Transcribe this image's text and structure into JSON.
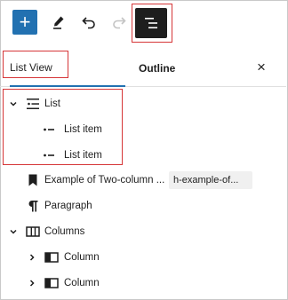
{
  "toolbar": {
    "add_label": "+",
    "items": [
      {
        "name": "add-block",
        "icon": "plus-icon"
      },
      {
        "name": "tools",
        "icon": "pencil-icon"
      },
      {
        "name": "undo",
        "icon": "undo-icon"
      },
      {
        "name": "redo",
        "icon": "redo-icon"
      },
      {
        "name": "list-view",
        "icon": "list-view-icon"
      }
    ],
    "accent": "#2271b1"
  },
  "tabs": [
    {
      "label": "List View",
      "active": true
    },
    {
      "label": "Outline",
      "active": false
    }
  ],
  "close_label": "×",
  "tree": {
    "list": {
      "label": "List",
      "icon": "list-icon",
      "expanded": true
    },
    "list_items": [
      {
        "label": "List item",
        "icon": "list-item-icon"
      },
      {
        "label": "List item",
        "icon": "list-item-icon"
      }
    ],
    "heading": {
      "label": "Example of Two-column ...",
      "anchor": "h-example-of...",
      "icon": "bookmark-icon"
    },
    "paragraph": {
      "label": "Paragraph",
      "icon": "pilcrow-icon"
    },
    "columns": {
      "label": "Columns",
      "icon": "columns-icon",
      "expanded": true
    },
    "column_items": [
      {
        "label": "Column",
        "icon": "column-icon"
      },
      {
        "label": "Column",
        "icon": "column-icon"
      }
    ]
  },
  "colors": {
    "highlight": "#d63638",
    "text": "#1e1e1e",
    "tag_bg": "#f0f0f0"
  }
}
